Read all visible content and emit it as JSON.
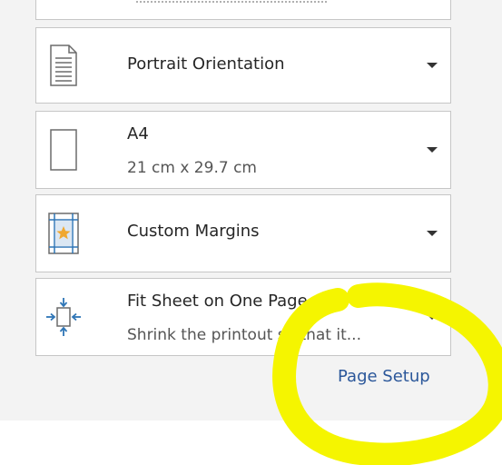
{
  "settings": {
    "orientation": {
      "title": "Portrait Orientation"
    },
    "paper_size": {
      "title": "A4",
      "subtitle": "21 cm x 29.7 cm"
    },
    "margins": {
      "title": "Custom Margins"
    },
    "scaling": {
      "title": "Fit Sheet on One Page",
      "subtitle": "Shrink the printout so that it..."
    }
  },
  "page_setup_link": "Page Setup",
  "colors": {
    "panel_background": "#f3f3f3",
    "link": "#2b579a",
    "highlight": "#f5f500",
    "margin_icon_blue": "#2e75b6",
    "margin_icon_star": "#f0a830"
  }
}
